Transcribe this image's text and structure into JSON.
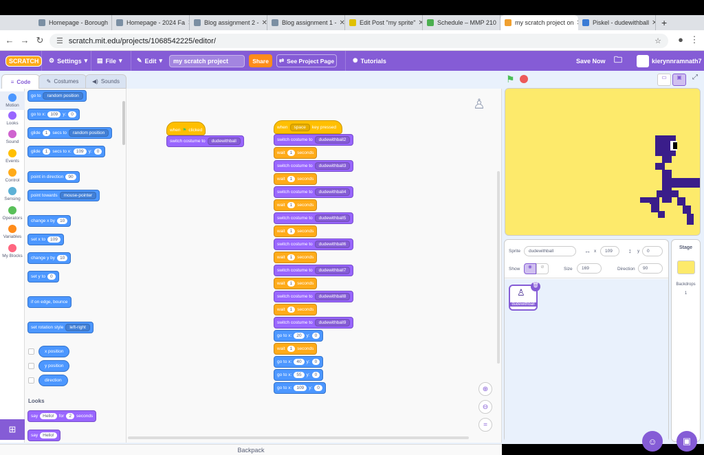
{
  "browser": {
    "tabs": [
      {
        "label": "Homepage - Borough",
        "color": "#7b8fa3"
      },
      {
        "label": "Homepage - 2024 Fa",
        "color": "#7b8fa3"
      },
      {
        "label": "Blog assignment 2 -",
        "color": "#7b8fa3"
      },
      {
        "label": "Blog assignment 1 -",
        "color": "#7b8fa3"
      },
      {
        "label": "Edit Post \"my sprite\"",
        "color": "#e0c000"
      },
      {
        "label": "Schedule – MMP 210",
        "color": "#4caf50"
      },
      {
        "label": "my scratch project on",
        "color": "#f0a030"
      },
      {
        "label": "Piskel - dudewithball",
        "color": "#3a7bd5"
      }
    ],
    "url": "scratch.mit.edu/projects/1068542225/editor/",
    "new_tab": "+"
  },
  "menubar": {
    "logo": "SCRATCH",
    "settings": "Settings",
    "file": "File",
    "edit": "Edit",
    "project_title": "my scratch project",
    "share": "Share",
    "see_project": "See Project Page",
    "tutorials": "Tutorials",
    "save_now": "Save Now",
    "username": "kierynnramnath7"
  },
  "editor_tabs": {
    "code": "Code",
    "costumes": "Costumes",
    "sounds": "Sounds"
  },
  "categories": [
    {
      "label": "Motion",
      "color": "#4c97ff"
    },
    {
      "label": "Looks",
      "color": "#9966ff"
    },
    {
      "label": "Sound",
      "color": "#cf63cf"
    },
    {
      "label": "Events",
      "color": "#ffbf00"
    },
    {
      "label": "Control",
      "color": "#ffab19"
    },
    {
      "label": "Sensing",
      "color": "#5cb1d6"
    },
    {
      "label": "Operators",
      "color": "#59c059"
    },
    {
      "label": "Variables",
      "color": "#ff8c1a"
    },
    {
      "label": "My Blocks",
      "color": "#ff6680"
    }
  ],
  "palette": {
    "goto": "go to",
    "goto_dd": "random position",
    "gotoxy": "go to x:",
    "x_val": "109",
    "y_lbl": "y:",
    "y_val": "0",
    "glide": "glide",
    "glide_secs": "1",
    "secs_to": "secs to",
    "glide_dd": "random position",
    "glide_xy": "secs to x:",
    "point_dir": "point in direction",
    "dir_val": "90",
    "point_towards": "point towards",
    "towards_dd": "mouse-pointer",
    "change_x": "change x by",
    "change_val": "10",
    "set_x": "set x to",
    "set_y": "set y to",
    "zero": "0",
    "change_y": "change y by",
    "bounce": "if on edge, bounce",
    "rot_style": "set rotation style",
    "rot_dd": "left-right",
    "xpos": "x position",
    "ypos": "y position",
    "direction": "direction",
    "looks_heading": "Looks",
    "say": "say",
    "hello": "Hello!",
    "for": "for",
    "two": "2",
    "seconds": "seconds"
  },
  "scripts": {
    "flag_hat": {
      "when": "when",
      "clicked": "clicked",
      "switch": "switch costume to",
      "costume": "dudewithball"
    },
    "key_hat": {
      "when": "when",
      "key": "space",
      "pressed": "key pressed"
    },
    "switch_label": "switch costume to",
    "wait_label": "wait",
    "wait_val": "1",
    "seconds": "seconds",
    "costumes": [
      "dudewithball2",
      "dudewithball3",
      "dudewithball4",
      "dudewithball5",
      "dudewithball6",
      "dudewithball7",
      "dudewithball8",
      "dudewithball9"
    ],
    "gotox": "go to x:",
    "gotoy": "y:",
    "moves": [
      {
        "x": "20",
        "y": "0"
      },
      {
        "x": "40",
        "y": "0"
      },
      {
        "x": "55",
        "y": "0"
      },
      {
        "x": "109",
        "y": "0"
      }
    ]
  },
  "sprite_info": {
    "sprite_label": "Sprite",
    "sprite_name": "dudewithball",
    "x_val": "109",
    "y_label": "y",
    "y_val": "0",
    "x_label": "x",
    "show_label": "Show",
    "size_label": "Size",
    "size_val": "169",
    "direction_label": "Direction",
    "direction_val": "90"
  },
  "sprite_tile": "dudewithball",
  "stage_pane": {
    "title": "Stage",
    "backdrops_label": "Backdrops",
    "backdrops_count": "1"
  },
  "backpack": "Backpack",
  "colors": {
    "scratch_purple": "#855cd6",
    "stage_bg": "#fdea6b",
    "sprite_color": "#3a1d8a"
  }
}
